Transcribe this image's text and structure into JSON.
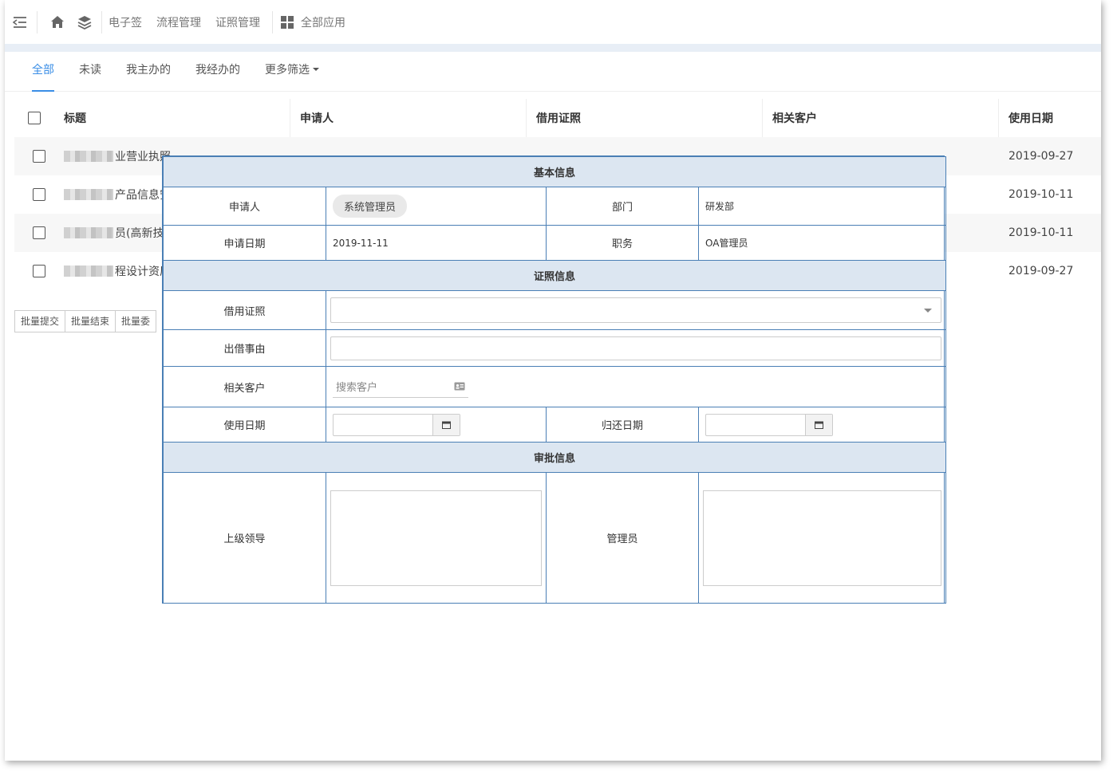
{
  "nav": {
    "links": [
      "电子签",
      "流程管理",
      "证照管理"
    ],
    "all_apps": "全部应用"
  },
  "tabs": [
    {
      "label": "全部",
      "active": true
    },
    {
      "label": "未读"
    },
    {
      "label": "我主办的"
    },
    {
      "label": "我经办的"
    },
    {
      "label": "更多筛选",
      "dropdown": true
    }
  ],
  "table": {
    "headers": {
      "title": "标题",
      "applicant": "申请人",
      "license": "借用证照",
      "customer": "相关客户",
      "date": "使用日期"
    },
    "rows": [
      {
        "title_visible": "业营业执照",
        "date": "2019-09-27"
      },
      {
        "title_visible": "产品信息安",
        "date": "2019-10-11"
      },
      {
        "title_visible": "员(高新技",
        "date": "2019-10-11"
      },
      {
        "title_visible": "程设计资质",
        "date": "2019-09-27"
      }
    ]
  },
  "batch_buttons": [
    "批量提交",
    "批量结束",
    "批量委"
  ],
  "form": {
    "basic_title": "基本信息",
    "applicant_label": "申请人",
    "applicant_value": "系统管理员",
    "dept_label": "部门",
    "dept_value": "研发部",
    "apply_date_label": "申请日期",
    "apply_date_value": "2019-11-11",
    "position_label": "职务",
    "position_value": "OA管理员",
    "license_title": "证照信息",
    "license_label": "借用证照",
    "reason_label": "出借事由",
    "customer_label": "相关客户",
    "customer_placeholder": "搜索客户",
    "use_date_label": "使用日期",
    "return_date_label": "归还日期",
    "approve_title": "审批信息",
    "leader_label": "上级领导",
    "admin_label": "管理员"
  },
  "colors": {
    "accent": "#3a8ee6",
    "section_bg": "#dce6f1",
    "border": "#4a7fb5"
  }
}
